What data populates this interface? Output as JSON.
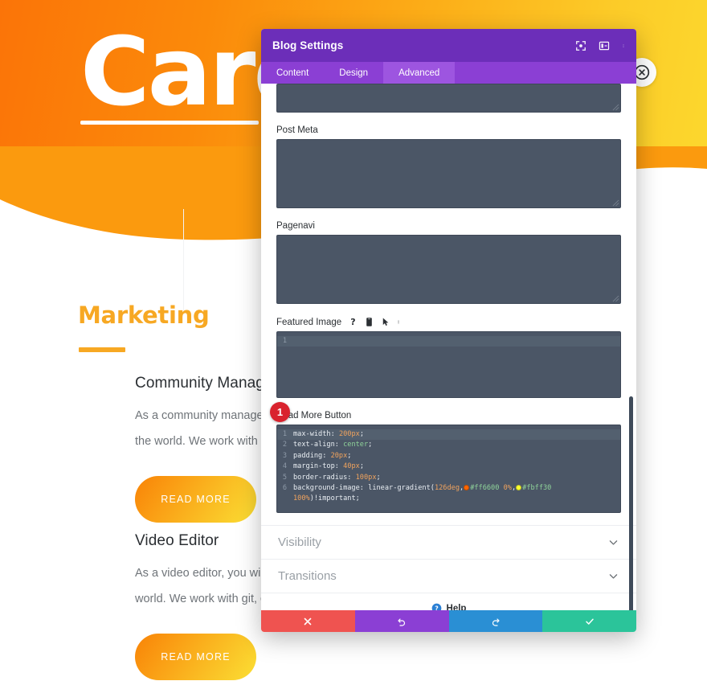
{
  "background": {
    "hero": {
      "title": "Career",
      "gradient_from": "#fb7408",
      "gradient_to": "#fcd92e"
    },
    "section": {
      "heading": "Marketing",
      "accent_color": "#f7a823"
    },
    "cards": [
      {
        "title": "Community Manager",
        "line1": "As a community manager, you will be working with people all around",
        "line2": "the world. We work with git, chat and more.",
        "button": "READ MORE"
      },
      {
        "title": "Video Editor",
        "line1": "As a video editor, you will be working with people all around the",
        "line2": "world. We work with git, chat and more.",
        "button": "READ MORE"
      }
    ]
  },
  "modal": {
    "title": "Blog Settings",
    "header_icons": [
      "target-icon",
      "layout-icon",
      "kebab-menu-icon"
    ],
    "tabs": [
      {
        "label": "Content",
        "active": false
      },
      {
        "label": "Design",
        "active": false
      },
      {
        "label": "Advanced",
        "active": true
      }
    ],
    "fields": [
      {
        "name": "post-title",
        "label": "",
        "type": "textarea",
        "value": "",
        "height": 36,
        "partial": true
      },
      {
        "name": "post-meta",
        "label": "Post Meta",
        "type": "textarea",
        "value": "",
        "height": 86
      },
      {
        "name": "pagenavi",
        "label": "Pagenavi",
        "type": "textarea",
        "value": "",
        "height": 86
      },
      {
        "name": "featured-image",
        "label": "Featured Image",
        "type": "code",
        "height": 83,
        "lines": 1,
        "icons": [
          "help-icon",
          "mobile-icon",
          "hover-pointer-icon",
          "kebab-menu-icon"
        ]
      }
    ],
    "code_field": {
      "label": "Read More Button",
      "badge": "1",
      "lines": [
        {
          "num": "1",
          "highlight": true,
          "prop": "max-width",
          "val": "200px"
        },
        {
          "num": "2",
          "highlight": false,
          "prop": "text-align",
          "kw": "center"
        },
        {
          "num": "3",
          "highlight": false,
          "prop": "padding",
          "val": "20px"
        },
        {
          "num": "4",
          "highlight": false,
          "prop": "margin-top",
          "val": "40px"
        },
        {
          "num": "5",
          "highlight": false,
          "prop": "border-radius",
          "val": "100px"
        }
      ],
      "gradient_line": {
        "num": "6",
        "prop": "background-image",
        "fn": "linear-gradient",
        "angle": "126deg",
        "stop1_color": "#ff6600",
        "stop1_pos": "0%",
        "stop2_color": "#fbff30",
        "stop2_pos": "100%",
        "important": ")!important;"
      }
    },
    "accordions": [
      {
        "label": "Visibility",
        "icon": "chevron-down-icon"
      },
      {
        "label": "Transitions",
        "icon": "chevron-down-icon"
      }
    ],
    "help": {
      "label": "Help",
      "icon": "help-circle-icon"
    },
    "footer_buttons": [
      {
        "name": "cancel-button",
        "icon": "close-icon",
        "color": "#ef5350"
      },
      {
        "name": "undo-button",
        "icon": "undo-icon",
        "color": "#8b3fd4"
      },
      {
        "name": "redo-button",
        "icon": "redo-icon",
        "color": "#2a8fd4"
      },
      {
        "name": "save-button",
        "icon": "check-icon",
        "color": "#2bc49a"
      }
    ]
  }
}
